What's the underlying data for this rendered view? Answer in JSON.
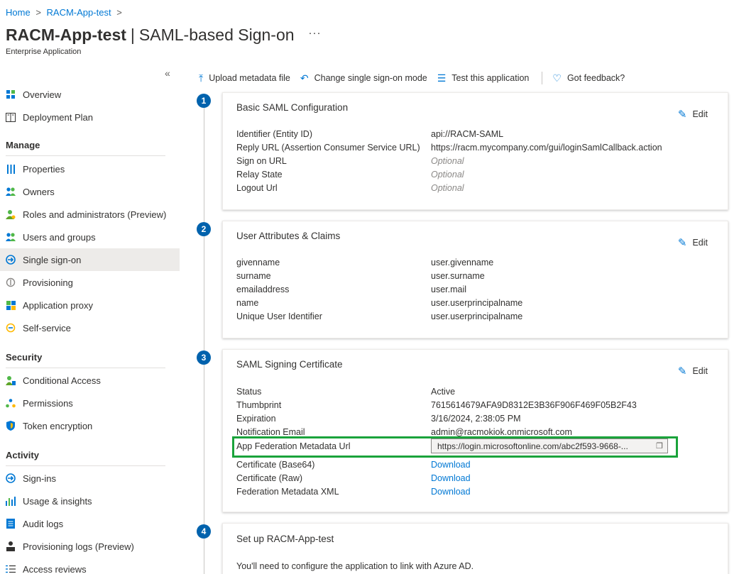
{
  "breadcrumb": {
    "home": "Home",
    "sep": ">",
    "app": "RACM-App-test",
    "sep2": ">"
  },
  "header": {
    "app_name": "RACM-App-test",
    "divider": "|",
    "page": "SAML-based Sign-on",
    "more": "···",
    "subtitle": "Enterprise Application"
  },
  "sidebar": {
    "collapse": "«",
    "top_items": [
      {
        "label": "Overview",
        "icon": "grid-icon"
      },
      {
        "label": "Deployment Plan",
        "icon": "book-icon"
      }
    ],
    "sections": [
      {
        "title": "Manage",
        "items": [
          {
            "label": "Properties",
            "icon": "properties-icon"
          },
          {
            "label": "Owners",
            "icon": "owners-icon"
          },
          {
            "label": "Roles and administrators (Preview)",
            "icon": "roles-icon"
          },
          {
            "label": "Users and groups",
            "icon": "users-icon"
          },
          {
            "label": "Single sign-on",
            "icon": "sso-icon",
            "active": true
          },
          {
            "label": "Provisioning",
            "icon": "provisioning-icon"
          },
          {
            "label": "Application proxy",
            "icon": "proxy-icon"
          },
          {
            "label": "Self-service",
            "icon": "self-service-icon"
          }
        ]
      },
      {
        "title": "Security",
        "items": [
          {
            "label": "Conditional Access",
            "icon": "conditional-access-icon"
          },
          {
            "label": "Permissions",
            "icon": "permissions-icon"
          },
          {
            "label": "Token encryption",
            "icon": "shield-icon"
          }
        ]
      },
      {
        "title": "Activity",
        "items": [
          {
            "label": "Sign-ins",
            "icon": "sign-ins-icon"
          },
          {
            "label": "Usage & insights",
            "icon": "chart-icon"
          },
          {
            "label": "Audit logs",
            "icon": "log-icon"
          },
          {
            "label": "Provisioning logs (Preview)",
            "icon": "user-log-icon"
          },
          {
            "label": "Access reviews",
            "icon": "list-icon"
          }
        ]
      }
    ]
  },
  "toolbar": {
    "upload": "Upload metadata file",
    "change": "Change single sign-on mode",
    "test": "Test this application",
    "feedback": "Got feedback?"
  },
  "steps": [
    "1",
    "2",
    "3",
    "4"
  ],
  "cards": {
    "basic": {
      "title": "Basic SAML Configuration",
      "edit": "Edit",
      "rows": [
        {
          "k": "Identifier (Entity ID)",
          "v": "api://RACM-SAML"
        },
        {
          "k": "Reply URL (Assertion Consumer Service URL)",
          "v": "https://racm.mycompany.com/gui/loginSamlCallback.action"
        },
        {
          "k": "Sign on URL",
          "v": "Optional"
        },
        {
          "k": "Relay State",
          "v": "Optional"
        },
        {
          "k": "Logout Url",
          "v": "Optional"
        }
      ]
    },
    "claims": {
      "title": "User Attributes & Claims",
      "edit": "Edit",
      "rows": [
        {
          "k": "givenname",
          "v": "user.givenname"
        },
        {
          "k": "surname",
          "v": "user.surname"
        },
        {
          "k": "emailaddress",
          "v": "user.mail"
        },
        {
          "k": "name",
          "v": "user.userprincipalname"
        },
        {
          "k": "Unique User Identifier",
          "v": "user.userprincipalname"
        }
      ]
    },
    "cert": {
      "title": "SAML Signing Certificate",
      "edit": "Edit",
      "rows": [
        {
          "k": "Status",
          "v": "Active"
        },
        {
          "k": "Thumbprint",
          "v": "7615614679AFA9D8312E3B36F906F469F05B2F43"
        },
        {
          "k": "Expiration",
          "v": "3/16/2024, 2:38:05 PM"
        },
        {
          "k": "Notification Email",
          "v": "admin@racmokiok.onmicrosoft.com"
        },
        {
          "k": "App Federation Metadata Url",
          "v": "https://login.microsoftonline.com/abc2f593-9668-..."
        },
        {
          "k": "Certificate (Base64)",
          "v": "Download"
        },
        {
          "k": "Certificate (Raw)",
          "v": "Download"
        },
        {
          "k": "Federation Metadata XML",
          "v": "Download"
        }
      ]
    },
    "setup": {
      "title": "Set up RACM-App-test",
      "description": "You'll need to configure the application to link with Azure AD."
    }
  }
}
